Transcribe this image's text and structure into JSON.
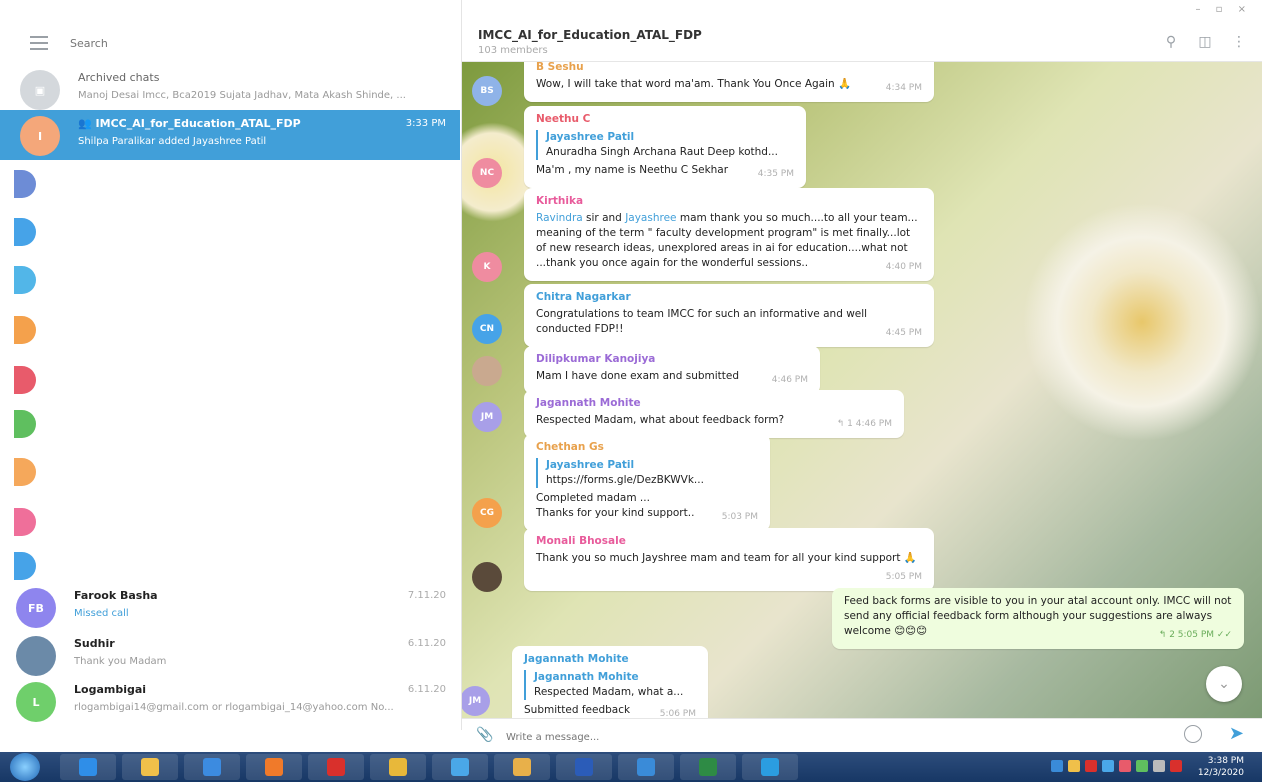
{
  "sidebar": {
    "search_placeholder": "Search",
    "archived": {
      "title": "Archived chats",
      "subtitle": "Manoj Desai Imcc, Bca2019 Sujata Jadhav, Mata Akash Shinde, ..."
    },
    "active_chat": {
      "title": "IMCC_AI_for_Education_ATAL_FDP",
      "time": "3:33 PM",
      "subtitle": "Shilpa Paralikar added Jayashree Patil"
    },
    "chats": [
      {
        "initials": "FB",
        "name": "Farook Basha",
        "time": "7.11.20",
        "subtitle": "Missed call",
        "color": "#8e85ee"
      },
      {
        "initials": "",
        "name": "Sudhir",
        "time": "6.11.20",
        "subtitle": "Thank you Madam",
        "color": "#6b8aa8"
      },
      {
        "initials": "L",
        "name": "Logambigai",
        "time": "6.11.20",
        "subtitle": "rlogambigai14@gmail.com or rlogambigai_14@yahoo.com  No...",
        "color": "#6fcf6b"
      }
    ],
    "stub_colors": [
      "#6d8cd6",
      "#46a3e8",
      "#52b6e8",
      "#f4a14c",
      "#e85b6b",
      "#5fbf5f",
      "#f5a85b",
      "#ef6f9a",
      "#46a3e8"
    ]
  },
  "chat": {
    "title": "IMCC_AI_for_Education_ATAL_FDP",
    "members": "103 members",
    "composer_placeholder": "Write a message..."
  },
  "messages": [
    {
      "initials": "BS",
      "sender": "B Seshu",
      "sender_color": "#e8a14c",
      "text": "Wow, I will take that word ma'am. Thank You Once Again 🙏",
      "time": "4:34 PM",
      "avatar_color": "#8fb3e8"
    },
    {
      "initials": "NC",
      "sender": "Neethu C",
      "sender_color": "#e85b6b",
      "reply_name": "Jayashree Patil",
      "reply_text": "Anuradha Singh Archana Raut Deep kothd...",
      "text": "Ma'm , my name is Neethu C Sekhar",
      "time": "4:35 PM",
      "avatar_color": "#ef8ca0"
    },
    {
      "initials": "K",
      "sender": "Kirthika",
      "sender_color": "#e85b9b",
      "mention1": "Ravindra",
      "mid1": " sir and ",
      "mention2": "Jayashree",
      "text": " mam thank you so much....to all your team... meaning of the  term \" faculty development program\" is met finally...lot of new research ideas, unexplored areas in ai for education....what not ...thank you once again for the wonderful sessions..",
      "time": "4:40 PM",
      "avatar_color": "#ef8ca0"
    },
    {
      "initials": "CN",
      "sender": "Chitra Nagarkar",
      "sender_color": "#419fd9",
      "text": "Congratulations to team IMCC for such an informative and well conducted FDP!!",
      "time": "4:45 PM",
      "avatar_color": "#46a3e8"
    },
    {
      "initials": "",
      "sender": "Dilipkumar Kanojiya",
      "sender_color": "#9b6bd6",
      "text": "Mam I have done exam and submitted",
      "time": "4:46 PM",
      "avatar_color": "#c9a98f"
    },
    {
      "initials": "JM",
      "sender": "Jagannath Mohite",
      "sender_color": "#9b6bd6",
      "text": "Respected Madam, what about feedback form?",
      "time": "4:46 PM",
      "replies": "1",
      "avatar_color": "#a89fe8"
    },
    {
      "initials": "CG",
      "sender": "Chethan Gs",
      "sender_color": "#e8a14c",
      "reply_name": "Jayashree Patil",
      "reply_text": "https://forms.gle/DezBKWVk...",
      "text": "Completed madam ...",
      "text2": "Thanks for your kind support..",
      "time": "5:03 PM",
      "avatar_color": "#f4a14c"
    },
    {
      "initials": "",
      "sender": "Monali Bhosale",
      "sender_color": "#e85b9b",
      "text": "Thank you so much Jayshree mam and team for all your kind support 🙏",
      "time": "5:05 PM",
      "avatar_color": "#5a4a3a"
    },
    {
      "outgoing": true,
      "text": "Feed back forms are visible to you in your atal account only. IMCC will not send any official feedback form although your suggestions are always welcome 😊😊😊",
      "time": "5:05 PM",
      "replies": "2"
    },
    {
      "initials": "JM",
      "sender": "Jagannath Mohite",
      "sender_color": "#419fd9",
      "reply_name": "Jagannath Mohite",
      "reply_text": "Respected Madam, what a...",
      "text": "Submitted feedback",
      "time": "5:06 PM",
      "avatar_color": "#a89fe8"
    }
  ],
  "taskbar": {
    "clock_time": "3:38 PM",
    "clock_date": "12/3/2020",
    "apps": [
      "internet-explorer",
      "file-explorer",
      "media",
      "firefox",
      "acrobat",
      "chrome",
      "network",
      "folder",
      "word",
      "presentation",
      "excel",
      "telegram"
    ],
    "app_colors": [
      "#2f8ee8",
      "#f0c04a",
      "#3c8be0",
      "#f07a2a",
      "#d9302c",
      "#e8b83a",
      "#4aa7e8",
      "#e8b04a",
      "#2b5cb8",
      "#3a8bd8",
      "#2e8b45",
      "#2b9de0"
    ]
  }
}
